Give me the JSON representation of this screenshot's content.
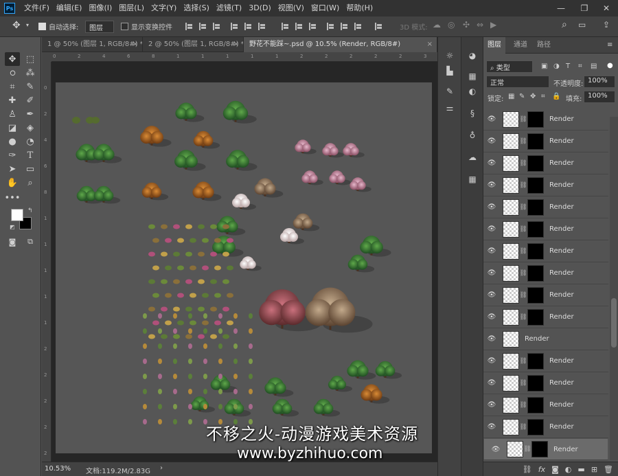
{
  "menubar": {
    "logo": "Ps",
    "items": [
      "文件(F)",
      "编辑(E)",
      "图像(I)",
      "图层(L)",
      "文字(Y)",
      "选择(S)",
      "滤镜(T)",
      "3D(D)",
      "视图(V)",
      "窗口(W)",
      "帮助(H)"
    ]
  },
  "options": {
    "auto_select_label": "自动选择:",
    "auto_select_value": "图层",
    "show_transform_label": "显示变换控件",
    "mode_3d_label": "3D 模式:"
  },
  "tabs": [
    {
      "label": "1 @ 50% (图层 1, RGB/8#) *"
    },
    {
      "label": "2 @ 50% (图层 1, RGB/8#) *"
    },
    {
      "label": "野花不能踩~.psd @ 10.5% (Render, RGB/8#)"
    }
  ],
  "ruler_top_ticks": [
    "0",
    "2",
    "4",
    "6",
    "8",
    "1",
    "1",
    "1",
    "1",
    "1",
    "2",
    "2",
    "2",
    "2",
    "2",
    "3"
  ],
  "ruler_left_ticks": [
    "0",
    "2",
    "4",
    "6",
    "8",
    "1",
    "1",
    "1",
    "1",
    "1",
    "2",
    "2",
    "2",
    "2",
    "2"
  ],
  "status": {
    "zoom": "10.53%",
    "doc": "文档:119.2M/2.83G"
  },
  "layers_panel": {
    "tabs": [
      "图层",
      "通道",
      "路径"
    ],
    "filter_label": "类型",
    "blend_mode": "正常",
    "opacity_label": "不透明度:",
    "opacity_value": "100%",
    "lock_label": "锁定:",
    "fill_label": "填充:",
    "fill_value": "100%",
    "layers": [
      {
        "name": "Render",
        "has_mask": true
      },
      {
        "name": "Render",
        "has_mask": true
      },
      {
        "name": "Render",
        "has_mask": true
      },
      {
        "name": "Render",
        "has_mask": true
      },
      {
        "name": "Render",
        "has_mask": true
      },
      {
        "name": "Render",
        "has_mask": true
      },
      {
        "name": "Render",
        "has_mask": true
      },
      {
        "name": "Render",
        "has_mask": true
      },
      {
        "name": "Render",
        "has_mask": true
      },
      {
        "name": "Render",
        "has_mask": true
      },
      {
        "name": "Render",
        "has_mask": false
      },
      {
        "name": "Render",
        "has_mask": true
      },
      {
        "name": "Render",
        "has_mask": true
      },
      {
        "name": "Render",
        "has_mask": true
      },
      {
        "name": "Render",
        "has_mask": true
      },
      {
        "name": "Render",
        "has_mask": true
      }
    ]
  },
  "watermark": {
    "line1": "不移之火-动漫游戏美术资源",
    "line2": "www.byzhihuo.com"
  }
}
